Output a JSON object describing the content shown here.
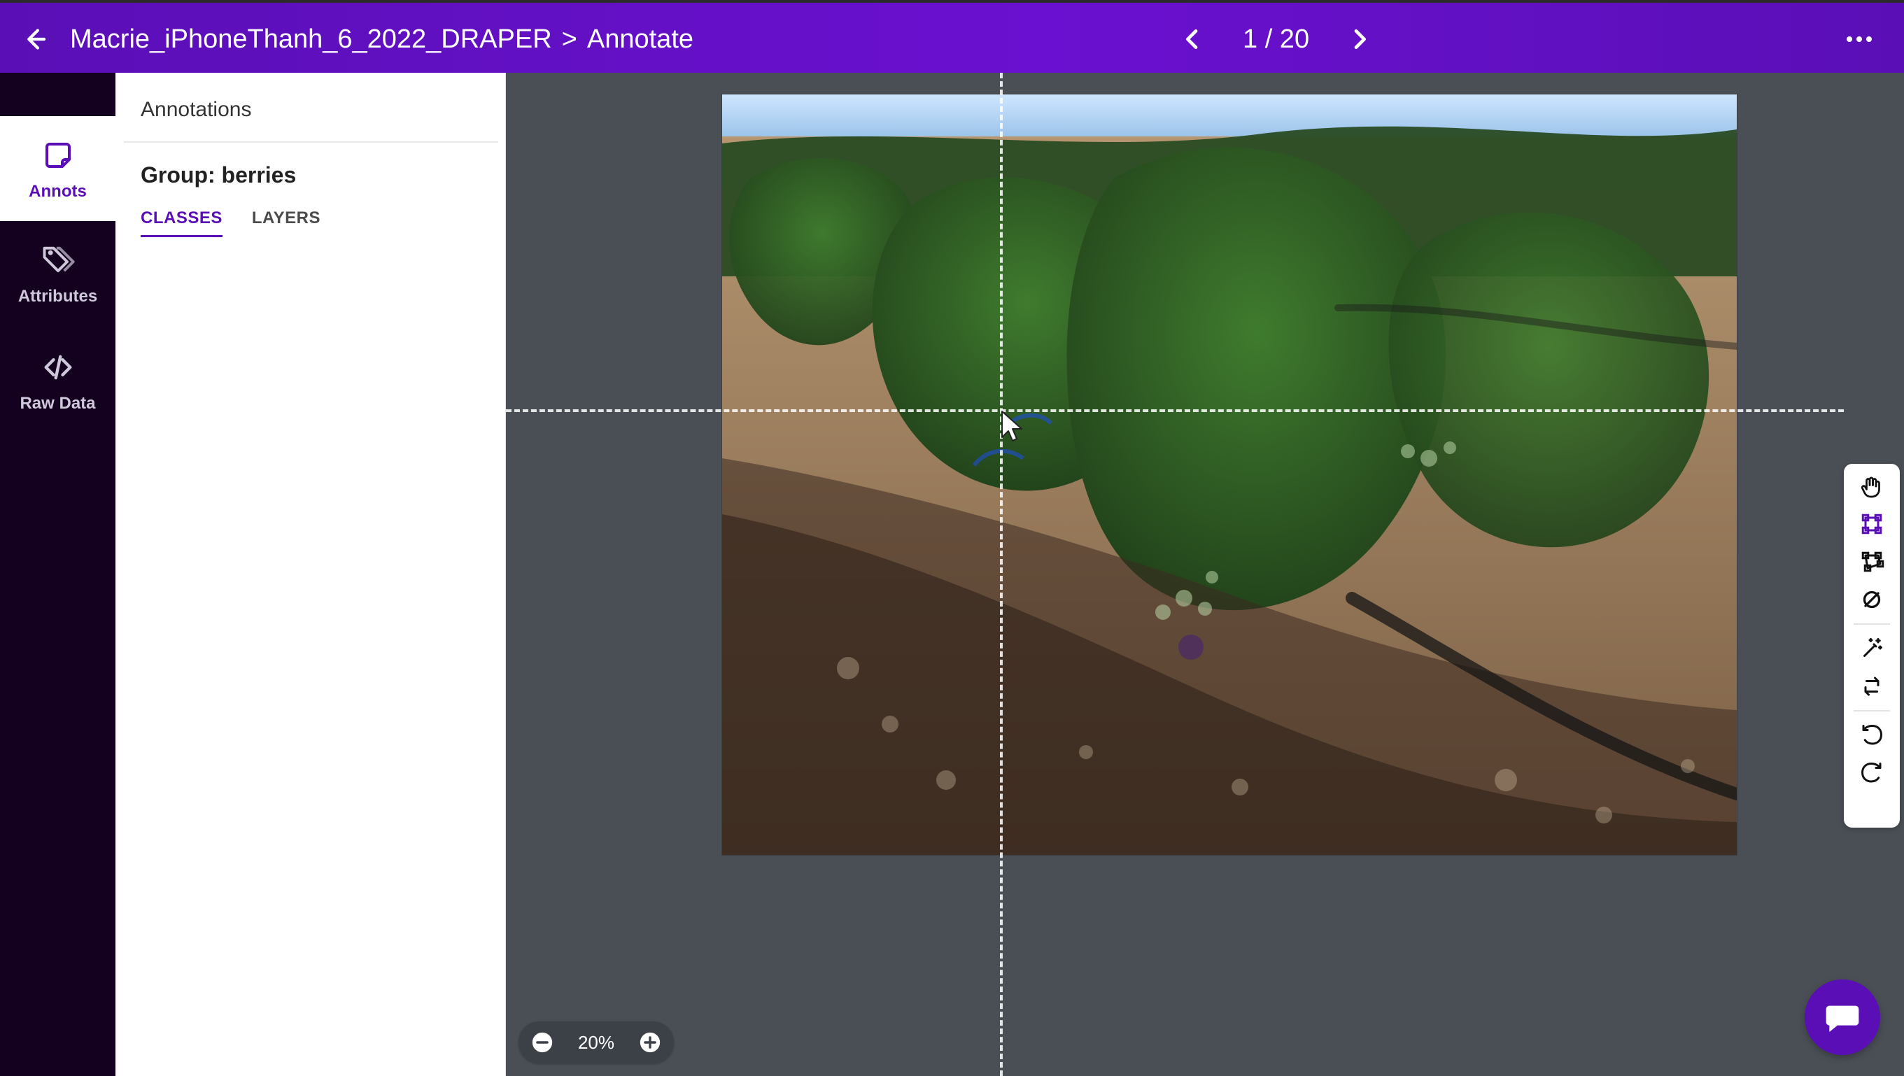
{
  "app": {
    "breadcrumb": {
      "project": "Macrie_iPhoneThanh_6_2022_DRAPER",
      "separator": ">",
      "page": "Annotate"
    },
    "pager": {
      "text": "1 / 20"
    },
    "icons": {
      "back": "arrow-left-icon",
      "prev": "chevron-left-icon",
      "next": "chevron-right-icon",
      "more": "more-horizontal-icon"
    },
    "colors": {
      "brand": "#5A0FB6",
      "rail_bg": "#14001F",
      "canvas_bg": "#4A4F56"
    }
  },
  "rail": {
    "items": [
      {
        "label": "Annots",
        "icon": "note-icon",
        "active": true
      },
      {
        "label": "Attributes",
        "icon": "tag-icon",
        "active": false
      },
      {
        "label": "Raw Data",
        "icon": "code-icon",
        "active": false
      }
    ]
  },
  "panel": {
    "header": "Annotations",
    "group_title": "Group: berries",
    "tabs": [
      {
        "label": "CLASSES",
        "active": true
      },
      {
        "label": "LAYERS",
        "active": false
      }
    ]
  },
  "canvas": {
    "zoom_label": "20%"
  },
  "tools": {
    "items": [
      {
        "icon": "hand-icon"
      },
      {
        "icon": "bounding-box-icon"
      },
      {
        "icon": "polygon-icon"
      },
      {
        "icon": "circle-slash-icon"
      },
      {
        "icon": "magic-wand-icon"
      },
      {
        "icon": "repeat-icon"
      },
      {
        "icon": "undo-icon"
      },
      {
        "icon": "redo-icon"
      }
    ]
  },
  "chat": {
    "icon": "chat-icon"
  }
}
